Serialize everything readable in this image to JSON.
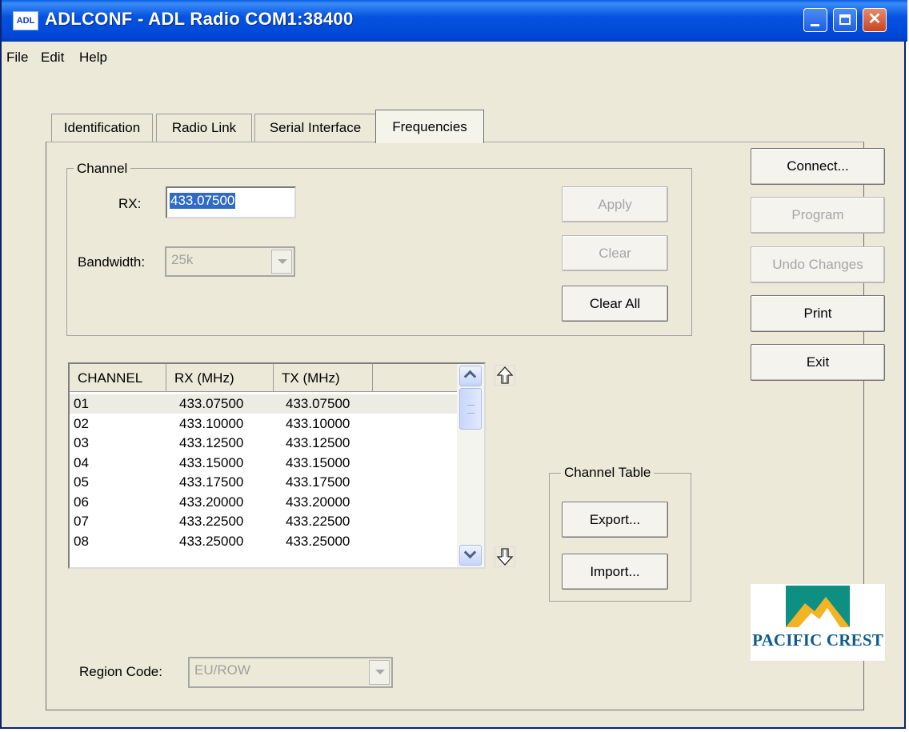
{
  "window": {
    "app_icon": "ADL",
    "title": "ADLCONF - ADL Radio COM1:38400"
  },
  "menu": [
    "File",
    "Edit",
    "Help"
  ],
  "tabs": [
    {
      "label": "Identification",
      "active": false
    },
    {
      "label": "Radio Link",
      "active": false
    },
    {
      "label": "Serial Interface",
      "active": false
    },
    {
      "label": "Frequencies",
      "active": true
    }
  ],
  "channel": {
    "group_label": "Channel",
    "rx_label": "RX:",
    "rx_value": "433.07500",
    "bandwidth_label": "Bandwidth:",
    "bandwidth_value": "25k",
    "apply_label": "Apply",
    "clear_label": "Clear",
    "clear_all_label": "Clear All"
  },
  "channel_list": {
    "columns": [
      "CHANNEL",
      "RX (MHz)",
      "TX (MHz)"
    ],
    "rows": [
      {
        "channel": "01",
        "rx": "433.07500",
        "tx": "433.07500"
      },
      {
        "channel": "02",
        "rx": "433.10000",
        "tx": "433.10000"
      },
      {
        "channel": "03",
        "rx": "433.12500",
        "tx": "433.12500"
      },
      {
        "channel": "04",
        "rx": "433.15000",
        "tx": "433.15000"
      },
      {
        "channel": "05",
        "rx": "433.17500",
        "tx": "433.17500"
      },
      {
        "channel": "06",
        "rx": "433.20000",
        "tx": "433.20000"
      },
      {
        "channel": "07",
        "rx": "433.22500",
        "tx": "433.22500"
      },
      {
        "channel": "08",
        "rx": "433.25000",
        "tx": "433.25000"
      }
    ],
    "selected_index": 0
  },
  "channel_table": {
    "group_label": "Channel Table",
    "export_label": "Export...",
    "import_label": "Import..."
  },
  "region": {
    "label": "Region Code:",
    "value": "EU/ROW"
  },
  "side_buttons": {
    "connect": "Connect...",
    "program": "Program",
    "undo": "Undo Changes",
    "print": "Print",
    "exit": "Exit"
  },
  "logo": {
    "text": "PACIFIC CREST"
  },
  "colors": {
    "title_bar": "#0046d5",
    "window_bg": "#ece9d8",
    "selection": "#316ac5",
    "logo_blue": "#0d5b8f",
    "logo_gold": "#f2b325",
    "logo_teal": "#0d8f82"
  },
  "icons": {
    "move_up": "move-up-arrow-icon",
    "move_down": "move-down-arrow-icon"
  }
}
